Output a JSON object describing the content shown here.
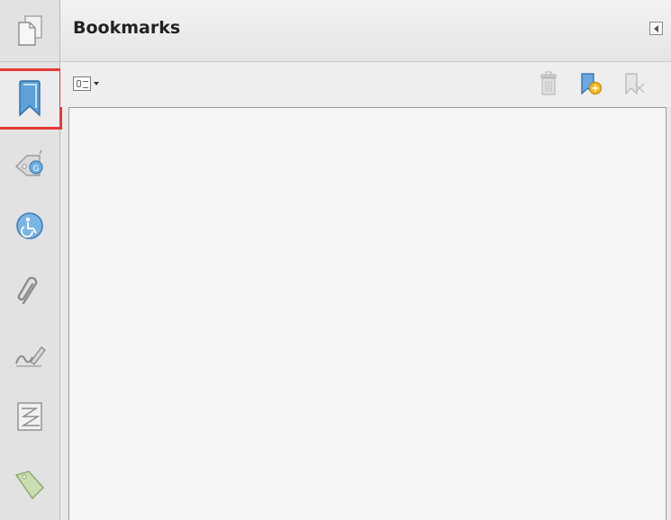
{
  "panel": {
    "title": "Bookmarks"
  },
  "rail": {
    "items": [
      {
        "name": "pages-icon",
        "selected": false
      },
      {
        "name": "bookmark-icon",
        "selected": true
      },
      {
        "name": "tag-icon",
        "selected": false
      },
      {
        "name": "accessibility-icon",
        "selected": false
      },
      {
        "name": "attachment-icon",
        "selected": false
      },
      {
        "name": "signature-icon",
        "selected": false
      },
      {
        "name": "content-icon",
        "selected": false
      },
      {
        "name": "label-icon",
        "selected": false
      }
    ]
  },
  "toolbar": {
    "icons": [
      "options-icon",
      "trash-icon",
      "new-bookmark-icon",
      "bookmark-from-selection-icon"
    ]
  },
  "colors": {
    "selection_outline": "#e53935",
    "accent_blue": "#4a90c8"
  }
}
